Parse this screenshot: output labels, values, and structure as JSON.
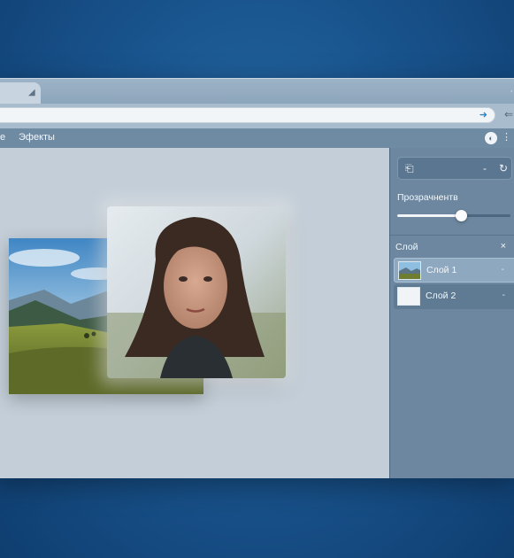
{
  "menubar": {
    "items": [
      {
        "label": "е"
      },
      {
        "label": "Эфекты"
      }
    ]
  },
  "panel": {
    "opacity_label": "Прозрачнентв",
    "opacity_value": 0.57,
    "layers_label": "Слой",
    "layers": [
      {
        "name": "Слой 1",
        "selected": true,
        "thumb": "landscape-thumbnail"
      },
      {
        "name": "Слой 2",
        "selected": false,
        "thumb": "blank-thumbnail"
      }
    ]
  },
  "icons": {
    "tab_close": "close-icon",
    "url_action": "arrow-icon",
    "nav_back": "back-arrow-icon",
    "menu_round": "circle-icon",
    "menu_more": "more-icon",
    "toolbar": [
      "bucket-icon",
      "minus-icon",
      "rotate-icon"
    ]
  },
  "colors": {
    "desktop": "#1a5690",
    "window": "#8ea6bc",
    "panel": "#6c879f",
    "canvas": "#c3ced8",
    "accent": "#2f86c5"
  }
}
